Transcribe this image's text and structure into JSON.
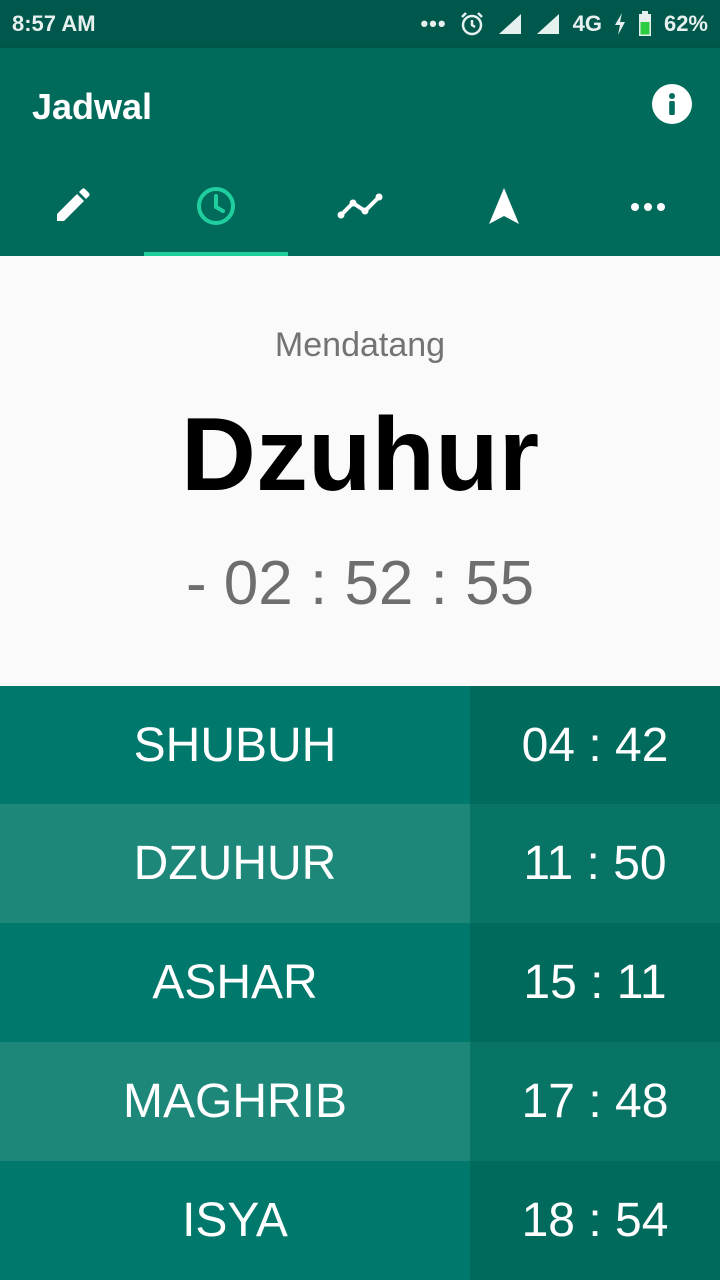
{
  "status_bar": {
    "time": "8:57 AM",
    "network": "4G",
    "battery": "62%",
    "icons": [
      "more-dots-icon",
      "alarm-icon",
      "signal-icon",
      "signal-icon",
      "charging-icon",
      "battery-icon"
    ]
  },
  "app_bar": {
    "title": "Jadwal",
    "info_icon": "info-icon"
  },
  "tabs": [
    {
      "icon": "pencil-icon",
      "active": false
    },
    {
      "icon": "clock-icon",
      "active": true
    },
    {
      "icon": "chart-line-icon",
      "active": false
    },
    {
      "icon": "navigation-arrow-icon",
      "active": false
    },
    {
      "icon": "more-horiz-icon",
      "active": false
    }
  ],
  "upcoming": {
    "label": "Mendatang",
    "name": "Dzuhur",
    "countdown": "- 02 : 52 : 55"
  },
  "schedule": [
    {
      "name": "SHUBUH",
      "time": "04 : 42"
    },
    {
      "name": "DZUHUR",
      "time": "11 : 50"
    },
    {
      "name": "ASHAR",
      "time": "15 : 11"
    },
    {
      "name": "MAGHRIB",
      "time": "17 : 48"
    },
    {
      "name": "ISYA",
      "time": "18 : 54"
    }
  ],
  "colors": {
    "primary": "#006a5b",
    "status_bar": "#00574b",
    "accent": "#1fcf9e"
  }
}
